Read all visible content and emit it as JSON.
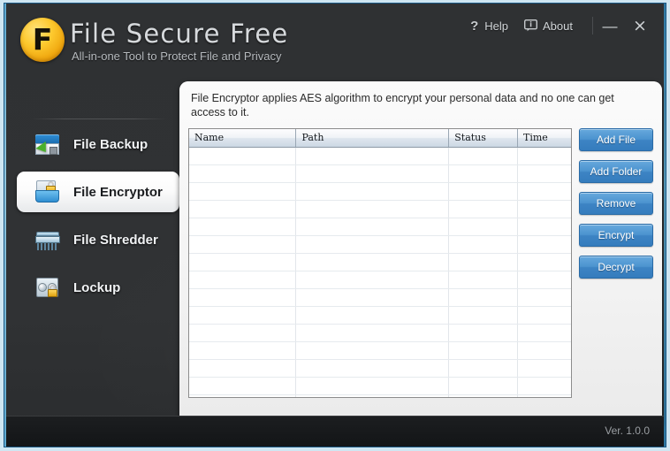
{
  "window": {
    "app_title": "File Secure Free",
    "tagline": "All-in-one Tool to Protect File and Privacy",
    "logo_letter": "F",
    "accent_color": "#3d84c4",
    "logo_color": "#fdc92e",
    "titlebar": {
      "help_label": "Help",
      "help_icon": "question-mark-icon",
      "about_label": "About",
      "about_icon": "info-bubble-icon",
      "minimize_glyph": "—",
      "close_glyph": "×"
    }
  },
  "sidebar": {
    "items": [
      {
        "label": "File Backup",
        "icon": "file-backup-icon",
        "selected": false
      },
      {
        "label": "File Encryptor",
        "icon": "file-encryptor-icon",
        "selected": true
      },
      {
        "label": "File Shredder",
        "icon": "file-shredder-icon",
        "selected": false
      },
      {
        "label": "Lockup",
        "icon": "lockup-icon",
        "selected": false
      }
    ]
  },
  "main": {
    "description": "File Encryptor applies AES algorithm to encrypt your personal data and no one can get access to it.",
    "table": {
      "columns": [
        "Name",
        "Path",
        "Status",
        "Time"
      ],
      "rows": [],
      "empty_row_count": 16
    },
    "buttons": [
      {
        "label": "Add File"
      },
      {
        "label": "Add Folder"
      },
      {
        "label": "Remove"
      },
      {
        "label": "Encrypt"
      },
      {
        "label": "Decrypt"
      }
    ]
  },
  "status": {
    "version": "Ver. 1.0.0"
  }
}
